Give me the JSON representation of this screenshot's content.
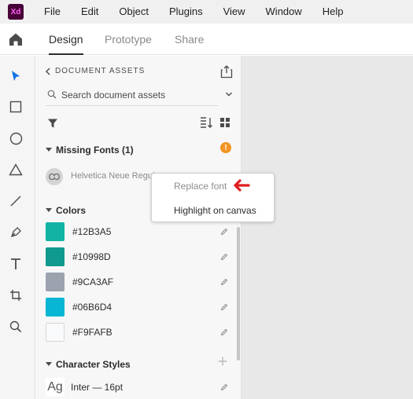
{
  "menubar": {
    "logo": "Xd",
    "items": [
      "File",
      "Edit",
      "Object",
      "Plugins",
      "View",
      "Window",
      "Help"
    ]
  },
  "tabs": {
    "design": "Design",
    "prototype": "Prototype",
    "share": "Share"
  },
  "tools": [
    "select-tool",
    "rectangle-tool",
    "ellipse-tool",
    "triangle-tool",
    "line-tool",
    "pen-tool",
    "text-tool",
    "artboard-tool",
    "zoom-tool"
  ],
  "panel": {
    "title": "DOCUMENT ASSETS",
    "search_placeholder": "Search document assets",
    "missing_fonts": {
      "header": "Missing Fonts (1)",
      "warning_glyph": "!",
      "font_name": "Helvetica Neue Regular"
    },
    "colors": {
      "header": "Colors",
      "items": [
        {
          "label": "#12B3A5",
          "hex": "#12B3A5"
        },
        {
          "label": "#10998D",
          "hex": "#10998D"
        },
        {
          "label": "#9CA3AF",
          "hex": "#9CA3AF"
        },
        {
          "label": "#06B6D4",
          "hex": "#06B6D4"
        },
        {
          "label": "#F9FAFB",
          "hex": "#F9FAFB"
        }
      ]
    },
    "character_styles": {
      "header": "Character Styles",
      "glyph": "Ag",
      "items": [
        {
          "label": "Inter — 16pt"
        }
      ]
    }
  },
  "context_menu": {
    "replace_font": "Replace font",
    "highlight": "Highlight on canvas"
  },
  "colors": {
    "accent": "#1473e6",
    "arrow": "#e11d1d",
    "warning": "#f29423"
  }
}
